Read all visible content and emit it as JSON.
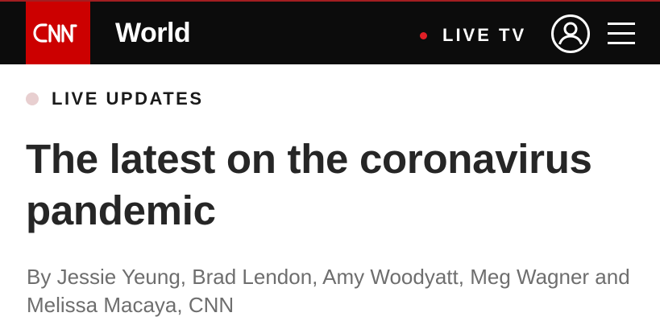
{
  "header": {
    "logo_text": "CNN",
    "section": "World",
    "live_tv_label": "LIVE TV",
    "user_icon": "user-account-icon",
    "menu_icon": "hamburger-menu-icon",
    "colors": {
      "bar": "#0c0c0c",
      "brand_red": "#cc0000",
      "live_dot": "#e01f26"
    }
  },
  "article": {
    "badge": "LIVE UPDATES",
    "headline": "The latest on the coronavirus pandemic",
    "byline": "By Jessie Yeung, Brad Lendon, Amy Woodyatt, Meg Wagner and Melissa Macaya, CNN"
  }
}
